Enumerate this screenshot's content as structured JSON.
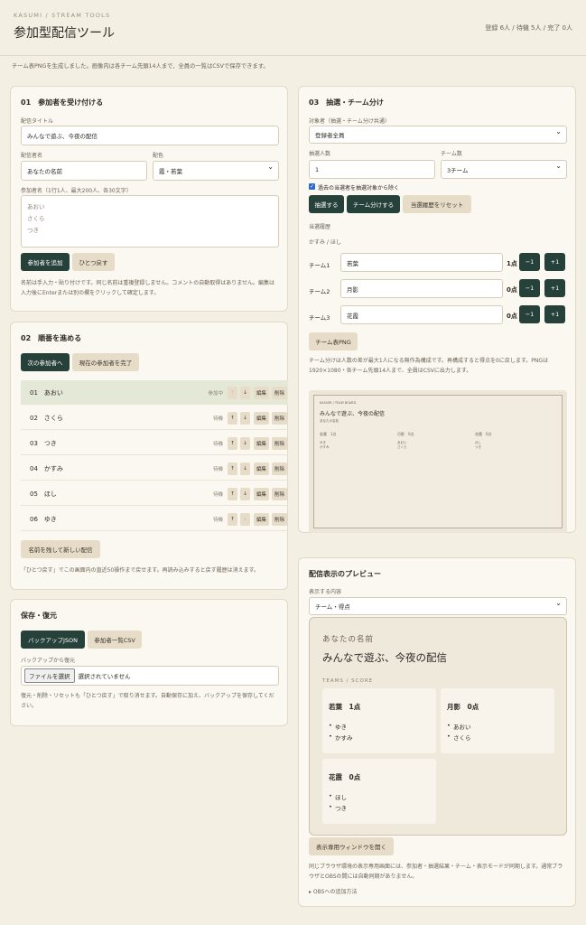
{
  "header": {
    "brand": "KASUMI / STREAM TOOLS",
    "title": "参加型配信ツール",
    "counts": "登録 6人 / 待機 5人 / 完了 0人"
  },
  "notice": "チーム表PNGを生成しました。画像内は各チーム先頭14人まで、全員の一覧はCSVで保存できます。",
  "reception": {
    "title": "01　参加者を受け付ける",
    "stream_title_label": "配信タイトル",
    "stream_title_value": "みんなで遊ぶ、今夜の配信",
    "streamer_label": "配信者名",
    "streamer_value": "あなたの名前",
    "color_label": "配色",
    "color_value": "霞・若葉",
    "names_label": "参加者名（1行1人、最大200人、各30文字）",
    "names_placeholder": [
      "あおい",
      "さくら",
      "つき"
    ],
    "add_button": "参加者を追加",
    "undo_button": "ひとつ戻す",
    "note": "名前は手入力・貼り付けです。同じ名前は重複登録しません。コメントの自動取得はありません。編集は入力後にEnterまたは別の欄をクリックして確定します。"
  },
  "order": {
    "title": "02　順番を進める",
    "next_button": "次の参加者へ",
    "complete_button": "現在の参加者を完了",
    "up": "↑",
    "down": "↓",
    "edit": "編集",
    "delete": "削除",
    "rows": [
      {
        "name": "01　あおい",
        "state": "参加中"
      },
      {
        "name": "02　さくら",
        "state": "待機"
      },
      {
        "name": "03　つき",
        "state": "待機"
      },
      {
        "name": "04　かすみ",
        "state": "待機"
      },
      {
        "name": "05　ほし",
        "state": "待機"
      },
      {
        "name": "06　ゆき",
        "state": "待機"
      }
    ],
    "new_stream_button": "名前を残して新しい配信",
    "note": "「ひとつ戻す」でこの画面内の直近50操作まで戻せます。再読み込みすると戻す履歴は消えます。"
  },
  "backup": {
    "title": "保存・復元",
    "json_button": "バックアップJSON",
    "csv_button": "参加者一覧CSV",
    "restore_label": "バックアップから復元",
    "file_button": "ファイルを選択",
    "file_status": "選択されていません",
    "note": "復元・削除・リセットも「ひとつ戻す」で取り消せます。自動保存に加え、バックアップを保存してください。"
  },
  "lottery": {
    "title": "03　抽選・チーム分け",
    "target_label": "対象者（抽選・チーム分け共通）",
    "target_value": "登録者全員",
    "count_label": "抽選人数",
    "count_value": "1",
    "teams_label": "チーム数",
    "teams_value": "3チーム",
    "exclude_label": "過去の当選者を抽選対象から除く",
    "draw_button": "抽選する",
    "split_button": "チーム分けする",
    "reset_button": "当選履歴をリセット",
    "history_label": "当選履歴",
    "history_value": "かすみ / ほし",
    "minus": "−1",
    "plus": "+1",
    "teams": [
      {
        "label": "チーム1",
        "name": "若葉",
        "points": "1点"
      },
      {
        "label": "チーム2",
        "name": "月影",
        "points": "0点"
      },
      {
        "label": "チーム3",
        "name": "花霞",
        "points": "0点"
      }
    ],
    "png_button": "チーム表PNG",
    "note": "チーム分けは人数の差が最大1人になる無作為構成です。再構成すると得点を0に戻します。PNGは1920×1080・各チーム先頭14人まで、全員はCSVに出力します。"
  },
  "thumbnail": {
    "brand": "KASUMI / TEAM BOARD",
    "title": "みんなで遊ぶ、今夜の配信",
    "streamer": "あなたの名前",
    "teams": [
      {
        "head": "若葉　1点",
        "members": [
          "ゆき",
          "かすみ"
        ]
      },
      {
        "head": "月影　0点",
        "members": [
          "あおい",
          "さくら"
        ]
      },
      {
        "head": "花霞　0点",
        "members": [
          "ほし",
          "つき"
        ]
      }
    ]
  },
  "preview": {
    "title": "配信表示のプレビュー",
    "content_label": "表示する内容",
    "content_value": "チーム・得点",
    "streamer": "あなたの名前",
    "stream_title": "みんなで遊ぶ、今夜の配信",
    "section": "TEAMS / SCORE",
    "teams": [
      {
        "head": "若葉　1点",
        "members": [
          "ゆき",
          "かすみ"
        ]
      },
      {
        "head": "月影　0点",
        "members": [
          "あおい",
          "さくら"
        ]
      },
      {
        "head": "花霞　0点",
        "members": [
          "ほし",
          "つき"
        ]
      }
    ],
    "open_button": "表示専用ウィンドウを開く",
    "note": "同じブラウザ環境の表示専用画面には、参加者・抽選結果・チーム・表示モードが同期します。通常ブラウザとOBSの間には自動同期がありません。",
    "obs_link": "OBSへの追加方法"
  }
}
